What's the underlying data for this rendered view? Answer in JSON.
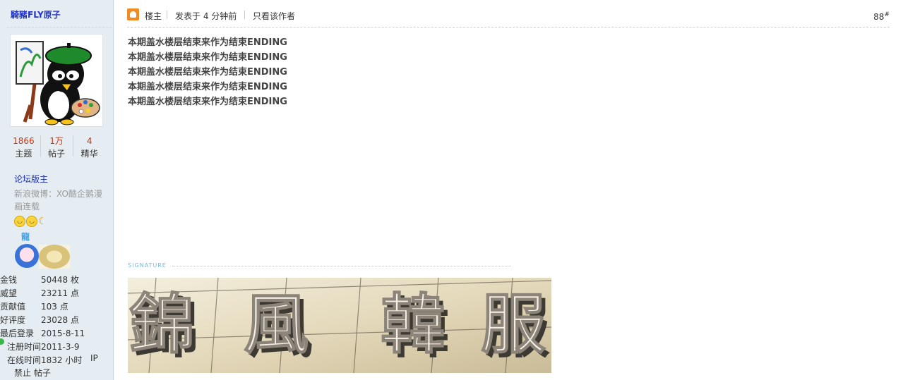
{
  "author": {
    "name": "騎豬FLY原子",
    "stats": [
      {
        "value": "1866",
        "label": "主题"
      },
      {
        "value": "1万",
        "label": "帖子"
      },
      {
        "value": "4",
        "label": "精华"
      }
    ],
    "group": "论坛版主",
    "weibo": "新浪微博：XO酷企鹅漫画连载",
    "medal_title": "龍",
    "info": [
      {
        "key": "金钱",
        "value": "50448 枚"
      },
      {
        "key": "威望",
        "value": "23211 点"
      },
      {
        "key": "贡献值",
        "value": "103 点"
      },
      {
        "key": "好评度",
        "value": "23028 点"
      },
      {
        "key": "最后登录",
        "value": "2015-8-11"
      },
      {
        "key": "注册时间",
        "value": "2011-3-9"
      },
      {
        "key": "在线时间",
        "value": "1832 小时"
      }
    ],
    "ip_label": "IP",
    "ban_label": "禁止 帖子"
  },
  "post": {
    "owner_label": "楼主",
    "posted": "发表于 4 分钟前",
    "only_author": "只看该作者",
    "floor": "88",
    "floor_mark": "#",
    "lines": [
      "本期盖水楼层结束来作为结束ENDING",
      "本期盖水楼层结束来作为结束ENDING",
      "本期盖水楼层结束来作为结束ENDING",
      "本期盖水楼层结束来作为结束ENDING",
      "本期盖水楼层结束来作为结束ENDING"
    ],
    "signature_label": "SIGNATURE",
    "signature_chars": [
      "錦",
      "風",
      "韓",
      "服"
    ]
  },
  "colors": {
    "sidebar_bg": "#e5edf2",
    "author_link": "#2133c9",
    "stat_number": "#c9330f",
    "group_link": "#1f2fa8",
    "owner_icon": "#f08a24"
  }
}
